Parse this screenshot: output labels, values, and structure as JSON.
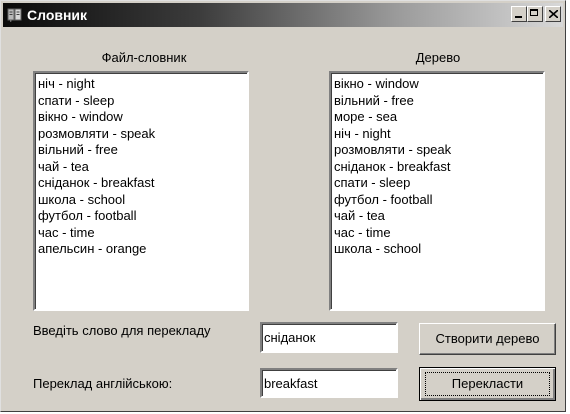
{
  "window": {
    "title": "Словник",
    "icon": "dictionary-app-icon",
    "buttons": {
      "minimize": "minimize-icon",
      "maximize": "maximize-icon",
      "close": "close-icon"
    }
  },
  "file_list": {
    "label": "Файл-словник",
    "items": [
      "ніч - night",
      "спати - sleep",
      "вікно - window",
      "розмовляти - speak",
      "вільний - free",
      "чай - tea",
      "сніданок - breakfast",
      "школа - school",
      "футбол - football",
      "час - time",
      "апельсин - orange"
    ]
  },
  "tree_list": {
    "label": "Дерево",
    "items": [
      "вікно - window",
      "вільний - free",
      "море - sea",
      "ніч - night",
      "розмовляти - speak",
      "сніданок - breakfast",
      "спати - sleep",
      "футбол - football",
      "чай - tea",
      "час - time",
      "школа - school"
    ]
  },
  "form": {
    "word_label": "Введіть слово для перекладу",
    "word_value": "сніданок",
    "translation_label": "Переклад англійською:",
    "translation_value": "breakfast",
    "create_tree_button": "Створити дерево",
    "translate_button": "Перекласти"
  }
}
